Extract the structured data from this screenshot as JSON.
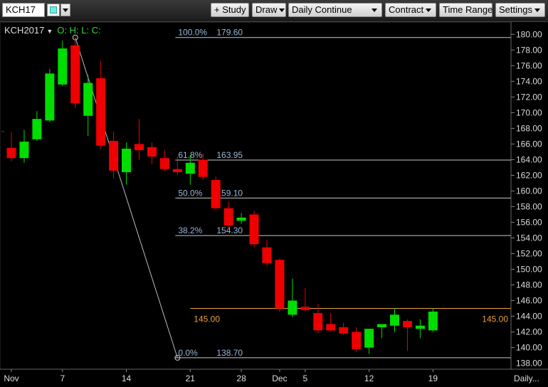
{
  "toolbar": {
    "symbol": "KCH17",
    "study_label": "+ Study",
    "draw_label": "Draw",
    "continuation_label": "Daily Continue",
    "contract_label": "Contract",
    "time_range_label": "Time Range",
    "settings_label": "Settings"
  },
  "legend": {
    "symbol": "KCH2017",
    "ohlc": "O: H: L: C:"
  },
  "colors": {
    "up": "#00dd00",
    "down": "#ee0000",
    "fib_line": "#c8c8c8",
    "fib_text": "#9ab6d8",
    "level_line": "#e8a23c",
    "grid": "#2a2a2a"
  },
  "chart_data": {
    "type": "candlestick",
    "ylim": [
      137.6,
      181.3
    ],
    "y_ticks": [
      140,
      142,
      144,
      146,
      148,
      150,
      152,
      154,
      156,
      158,
      160,
      162,
      164,
      166,
      168,
      170,
      172,
      174,
      176,
      178,
      180
    ],
    "y_tick_labels": [
      "140.00",
      "142.00",
      "144.00",
      "146.00",
      "148.00",
      "150.00",
      "152.00",
      "154.00",
      "156.00",
      "158.00",
      "160.00",
      "162.00",
      "164.00",
      "166.00",
      "168.00",
      "170.00",
      "172.00",
      "174.00",
      "176.00",
      "178.00",
      "180.00"
    ],
    "y_last_label": "138.00",
    "x_ticks": [
      {
        "index": 0,
        "label": "Nov"
      },
      {
        "index": 4,
        "label": "7"
      },
      {
        "index": 9,
        "label": "14"
      },
      {
        "index": 14,
        "label": "21"
      },
      {
        "index": 18,
        "label": "28"
      },
      {
        "index": 21,
        "label": "Dec"
      },
      {
        "index": 23,
        "label": "5"
      },
      {
        "index": 28,
        "label": "12"
      },
      {
        "index": 33,
        "label": "19"
      }
    ],
    "x_end_label": "Daily...",
    "candles": [
      {
        "o": 165.5,
        "h": 167.5,
        "l": 163.8,
        "c": 164.2
      },
      {
        "o": 164.2,
        "h": 167.8,
        "l": 163.6,
        "c": 166.3
      },
      {
        "o": 166.6,
        "h": 170.2,
        "l": 166.4,
        "c": 169.2
      },
      {
        "o": 169.0,
        "h": 175.6,
        "l": 168.8,
        "c": 175.0
      },
      {
        "o": 173.6,
        "h": 179.2,
        "l": 173.4,
        "c": 178.2
      },
      {
        "o": 178.6,
        "h": 179.6,
        "l": 170.6,
        "c": 171.2
      },
      {
        "o": 169.6,
        "h": 174.8,
        "l": 167.0,
        "c": 173.8
      },
      {
        "o": 174.4,
        "h": 176.6,
        "l": 165.4,
        "c": 165.8
      },
      {
        "o": 166.4,
        "h": 167.6,
        "l": 161.6,
        "c": 162.6
      },
      {
        "o": 162.4,
        "h": 166.2,
        "l": 160.8,
        "c": 165.4
      },
      {
        "o": 166.0,
        "h": 169.2,
        "l": 164.0,
        "c": 165.2
      },
      {
        "o": 165.6,
        "h": 166.2,
        "l": 163.4,
        "c": 164.4
      },
      {
        "o": 164.2,
        "h": 165.2,
        "l": 162.6,
        "c": 162.8
      },
      {
        "o": 162.8,
        "h": 164.4,
        "l": 162.0,
        "c": 162.4
      },
      {
        "o": 162.2,
        "h": 164.6,
        "l": 160.8,
        "c": 163.6
      },
      {
        "o": 164.0,
        "h": 164.8,
        "l": 161.4,
        "c": 161.8
      },
      {
        "o": 161.4,
        "h": 161.8,
        "l": 157.6,
        "c": 157.8
      },
      {
        "o": 157.8,
        "h": 158.6,
        "l": 155.2,
        "c": 155.6
      },
      {
        "o": 156.2,
        "h": 157.2,
        "l": 155.8,
        "c": 156.6
      },
      {
        "o": 157.0,
        "h": 157.4,
        "l": 152.8,
        "c": 153.2
      },
      {
        "o": 152.8,
        "h": 153.8,
        "l": 150.4,
        "c": 150.8
      },
      {
        "o": 151.2,
        "h": 151.4,
        "l": 144.6,
        "c": 145.0
      },
      {
        "o": 144.2,
        "h": 148.8,
        "l": 143.9,
        "c": 146.0
      },
      {
        "o": 145.2,
        "h": 147.6,
        "l": 144.6,
        "c": 144.8
      },
      {
        "o": 144.4,
        "h": 145.6,
        "l": 141.8,
        "c": 142.2
      },
      {
        "o": 143.0,
        "h": 144.4,
        "l": 142.0,
        "c": 142.2
      },
      {
        "o": 142.6,
        "h": 143.2,
        "l": 141.6,
        "c": 141.8
      },
      {
        "o": 142.0,
        "h": 142.6,
        "l": 139.4,
        "c": 139.8
      },
      {
        "o": 140.0,
        "h": 142.4,
        "l": 139.2,
        "c": 142.4
      },
      {
        "o": 142.6,
        "h": 142.8,
        "l": 141.2,
        "c": 143.0
      },
      {
        "o": 142.8,
        "h": 145.0,
        "l": 142.0,
        "c": 144.2
      },
      {
        "o": 143.4,
        "h": 143.6,
        "l": 139.6,
        "c": 142.6
      },
      {
        "o": 142.4,
        "h": 143.6,
        "l": 141.2,
        "c": 142.8
      },
      {
        "o": 142.2,
        "h": 145.0,
        "l": 142.0,
        "c": 144.6
      }
    ],
    "fib_levels": [
      {
        "pct": "100.0%",
        "value": 179.6,
        "label": "179.60"
      },
      {
        "pct": "61.8%",
        "value": 163.95,
        "label": "163.95"
      },
      {
        "pct": "50.0%",
        "value": 159.1,
        "label": "159.10"
      },
      {
        "pct": "38.2%",
        "value": 154.3,
        "label": "154.30"
      },
      {
        "pct": "0.0%",
        "value": 138.7,
        "label": "138.70"
      }
    ],
    "fib_anchor_high": {
      "index": 5,
      "value": 179.6
    },
    "fib_anchor_low": {
      "index": 13,
      "value": 138.7
    },
    "fib_start_index": 13,
    "horizontal_level": {
      "value": 145.0,
      "label": "145.00",
      "start_index": 14
    }
  }
}
